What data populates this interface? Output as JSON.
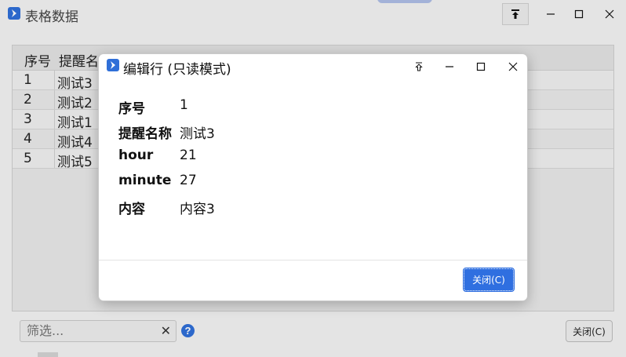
{
  "window": {
    "title": "表格数据",
    "brand_color": "#2f6fd8"
  },
  "table": {
    "headers": [
      "序号",
      "提醒名"
    ],
    "rows": [
      {
        "idx": "1",
        "name": "测试3"
      },
      {
        "idx": "2",
        "name": "测试2"
      },
      {
        "idx": "3",
        "name": "测试1"
      },
      {
        "idx": "4",
        "name": "测试4"
      },
      {
        "idx": "5",
        "name": "测试5"
      }
    ]
  },
  "footer": {
    "filter_placeholder": "筛选...",
    "clear_glyph": "✕",
    "help_glyph": "?",
    "close_label": "关闭(C)"
  },
  "dialog": {
    "title": "编辑行 (只读模式)",
    "fields": [
      {
        "label": "序号",
        "value": "1"
      },
      {
        "label": "提醒名称",
        "value": "测试3"
      },
      {
        "label": "hour",
        "value": "21"
      },
      {
        "label": "minute",
        "value": "27"
      },
      {
        "label": "内容",
        "value": "内容3"
      }
    ],
    "close_label": "关闭(C)",
    "accent": "#2f6fe0"
  }
}
